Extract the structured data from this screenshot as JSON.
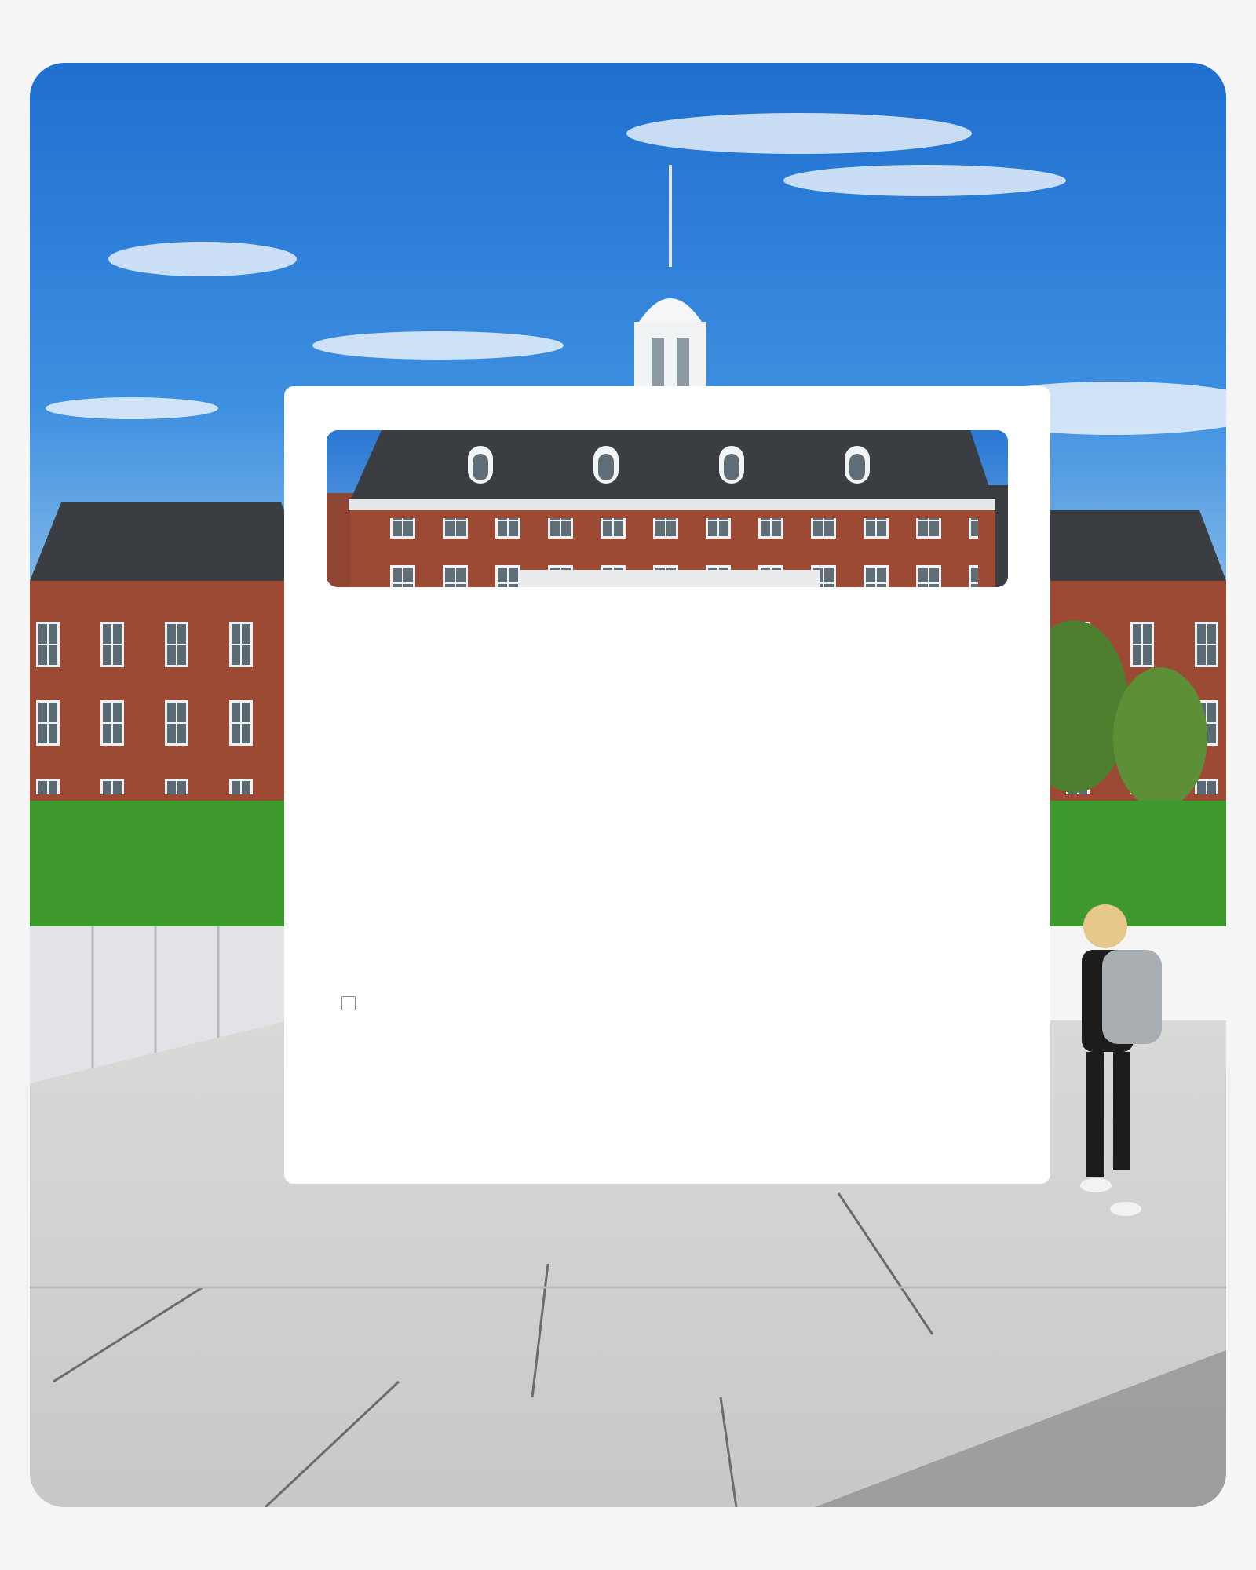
{
  "background": {
    "scene": "campus-photo",
    "colors": {
      "sky": "#2f7fd6",
      "brick": "#9c4a34",
      "roof": "#3a3d42",
      "lawn": "#3f9a2e",
      "plaza": "#cfd0ce"
    }
  },
  "card": {
    "banner": {
      "scene": "building-photo"
    },
    "checkbox": {
      "checked": false,
      "label": ""
    }
  }
}
